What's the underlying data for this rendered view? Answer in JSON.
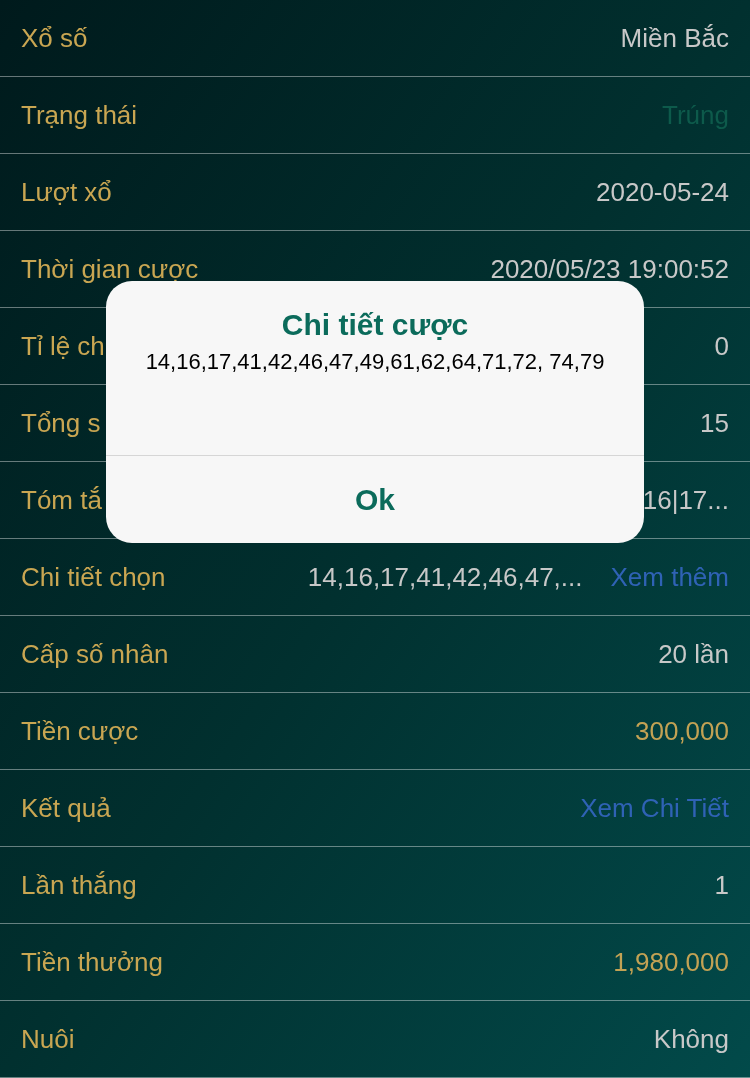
{
  "rows": [
    {
      "label": "Xổ số",
      "value": "Miền Bắc",
      "kind": "text"
    },
    {
      "label": "Trạng thái",
      "value": "Trúng",
      "kind": "status"
    },
    {
      "label": "Lượt xổ",
      "value": "2020-05-24",
      "kind": "text"
    },
    {
      "label": "Thời gian cược",
      "value": "2020/05/23 19:00:52",
      "kind": "text"
    },
    {
      "label": "Tỉ lệ ch",
      "value": "0",
      "kind": "text"
    },
    {
      "label": "Tổng s",
      "value": "15",
      "kind": "text"
    },
    {
      "label": "Tóm tắ",
      "value": "16|17...",
      "kind": "text"
    },
    {
      "label": "Chi tiết chọn",
      "value": "14,16,17,41,42,46,47,...",
      "link": "Xem thêm",
      "kind": "text"
    },
    {
      "label": "Cấp số nhân",
      "value": "20 lần",
      "kind": "text"
    },
    {
      "label": "Tiền cược",
      "value": "300,000",
      "kind": "money"
    },
    {
      "label": "Kết quả",
      "value": "Xem Chi Tiết",
      "kind": "link"
    },
    {
      "label": "Lần thắng",
      "value": "1",
      "kind": "text"
    },
    {
      "label": "Tiền thưởng",
      "value": "1,980,000",
      "kind": "money"
    },
    {
      "label": "Nuôi",
      "value": "Không",
      "kind": "text"
    }
  ],
  "dialog": {
    "title": "Chi tiết cược",
    "message": "14,16,17,41,42,46,47,49,61,62,64,71,72, 74,79",
    "button": "Ok"
  }
}
